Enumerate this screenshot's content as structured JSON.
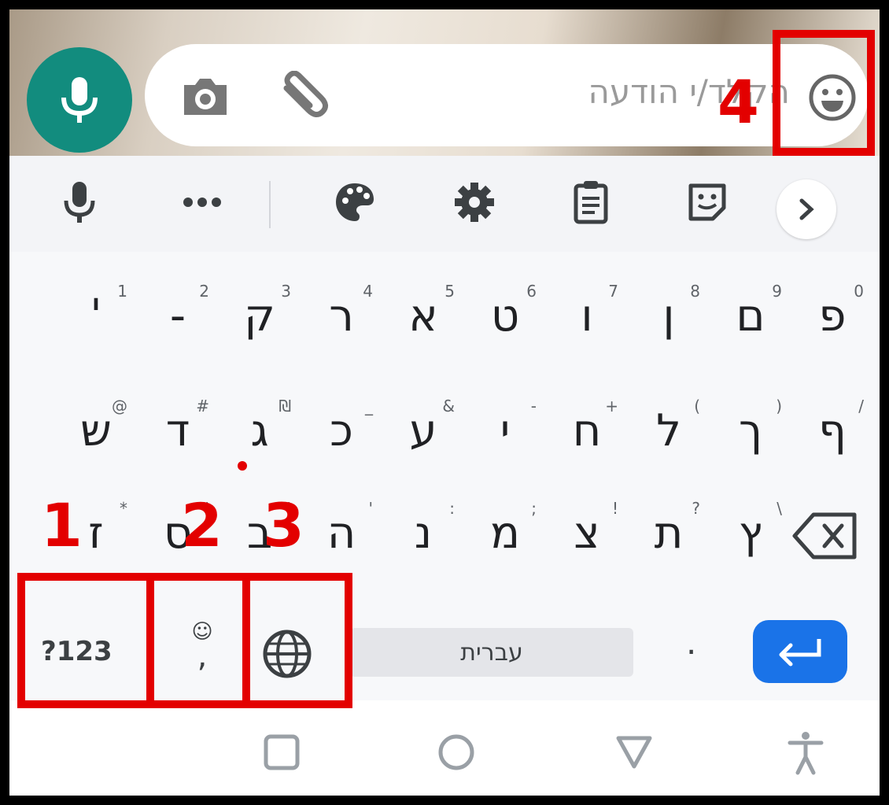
{
  "chat_bar": {
    "placeholder": "הקלד/י הודעה"
  },
  "toolbar": {
    "icons": [
      "mic-icon",
      "more-dots-icon",
      "palette-icon",
      "gear-icon",
      "clipboard-icon",
      "sticker-icon",
      "chevron-right-icon"
    ]
  },
  "keyboard": {
    "row1": [
      {
        "char": "'",
        "hint": "1"
      },
      {
        "char": "-",
        "hint": "2"
      },
      {
        "char": "ק",
        "hint": "3"
      },
      {
        "char": "ר",
        "hint": "4"
      },
      {
        "char": "א",
        "hint": "5"
      },
      {
        "char": "ט",
        "hint": "6"
      },
      {
        "char": "ו",
        "hint": "7"
      },
      {
        "char": "ן",
        "hint": "8"
      },
      {
        "char": "ם",
        "hint": "9"
      },
      {
        "char": "פ",
        "hint": "0"
      }
    ],
    "row2": [
      {
        "char": "ש",
        "hint": "@"
      },
      {
        "char": "ד",
        "hint": "#"
      },
      {
        "char": "ג",
        "hint": "₪"
      },
      {
        "char": "כ",
        "hint": "_"
      },
      {
        "char": "ע",
        "hint": "&"
      },
      {
        "char": "י",
        "hint": "-"
      },
      {
        "char": "ח",
        "hint": "+"
      },
      {
        "char": "ל",
        "hint": "("
      },
      {
        "char": "ך",
        "hint": ")"
      },
      {
        "char": "ף",
        "hint": "/"
      }
    ],
    "row3": [
      {
        "char": "ז",
        "hint": "*"
      },
      {
        "char": "ס",
        "hint": "\""
      },
      {
        "char": "ב",
        "hint": "'"
      },
      {
        "char": "ה",
        "hint": "'"
      },
      {
        "char": "נ",
        "hint": ":"
      },
      {
        "char": "מ",
        "hint": ";"
      },
      {
        "char": "צ",
        "hint": "!"
      },
      {
        "char": "ת",
        "hint": "?"
      },
      {
        "char": "ץ",
        "hint": "\\"
      }
    ],
    "symbols_label": "?123",
    "comma_label": ",",
    "comma_hint": "☺",
    "space_label": "עברית",
    "period_label": "."
  },
  "annotations": {
    "one": "1",
    "two": "2",
    "three": "3",
    "four": "4",
    "color": "#e30000"
  },
  "colors": {
    "mic_fab": "#128c7e",
    "enter_key": "#1a73e8"
  }
}
